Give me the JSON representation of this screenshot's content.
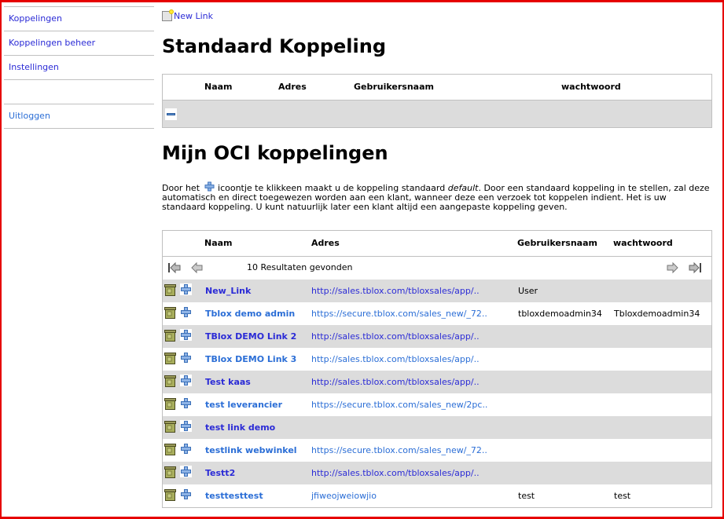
{
  "sidebar": {
    "items": [
      {
        "label": "Koppelingen"
      },
      {
        "label": "Koppelingen beheer"
      },
      {
        "label": "Instellingen"
      },
      {
        "label": ""
      },
      {
        "label": "Uitloggen"
      }
    ]
  },
  "toolbar": {
    "new_link_label": "New Link",
    "new_link_icon": "new-document-icon"
  },
  "standaard": {
    "title": "Standaard Koppeling",
    "columns": [
      "Naam",
      "Adres",
      "Gebruikersnaam",
      "wachtwoord"
    ],
    "row_icon": "minus-icon"
  },
  "oci": {
    "title": "Mijn OCI koppelingen",
    "description": {
      "part1": "Door het",
      "part2": "icoontje te klikkeen maakt u de koppeling standaard",
      "emphasis": "default",
      "part3": ". Door een standaard koppeling in te stellen, zal deze automatisch en direct toegewezen worden aan een klant, wanneer deze een verzoek tot koppelen indient. Het is uw standaard koppeling. U kunt natuurlijk later een klant altijd een aangepaste koppeling geven."
    },
    "columns": [
      "Naam",
      "Adres",
      "Gebruikersnaam",
      "wachtwoord"
    ],
    "pager": {
      "count_text": "10 Resultaten gevonden"
    },
    "rows": [
      {
        "name": "New_Link",
        "address": "http://sales.tblox.com/tbloxsales/app/..",
        "username": "User",
        "password": ""
      },
      {
        "name": "Tblox demo admin",
        "address": "https://secure.tblox.com/sales_new/_72..",
        "username": "tbloxdemoadmin34",
        "password": "Tbloxdemoadmin34"
      },
      {
        "name": "TBlox DEMO Link 2",
        "address": "http://sales.tblox.com/tbloxsales/app/..",
        "username": "",
        "password": ""
      },
      {
        "name": "TBlox DEMO Link 3",
        "address": "http://sales.tblox.com/tbloxsales/app/..",
        "username": "",
        "password": ""
      },
      {
        "name": "Test kaas",
        "address": "http://sales.tblox.com/tbloxsales/app/..",
        "username": "",
        "password": ""
      },
      {
        "name": "test leverancier",
        "address": "https://secure.tblox.com/sales_new/2pc..",
        "username": "",
        "password": ""
      },
      {
        "name": "test link demo",
        "address": "",
        "username": "",
        "password": ""
      },
      {
        "name": "testlink webwinkel",
        "address": "https://secure.tblox.com/sales_new/_72..",
        "username": "",
        "password": ""
      },
      {
        "name": "Testt2",
        "address": "http://sales.tblox.com/tbloxsales/app/..",
        "username": "",
        "password": ""
      },
      {
        "name": "testtesttest",
        "address": "jfiweojweiowjio",
        "username": "test",
        "password": "test"
      }
    ]
  },
  "colors": {
    "frame": "#e60000",
    "link": "#2b2bd6",
    "row_alt": "#dcdcdc",
    "border": "#c0c0c0"
  }
}
